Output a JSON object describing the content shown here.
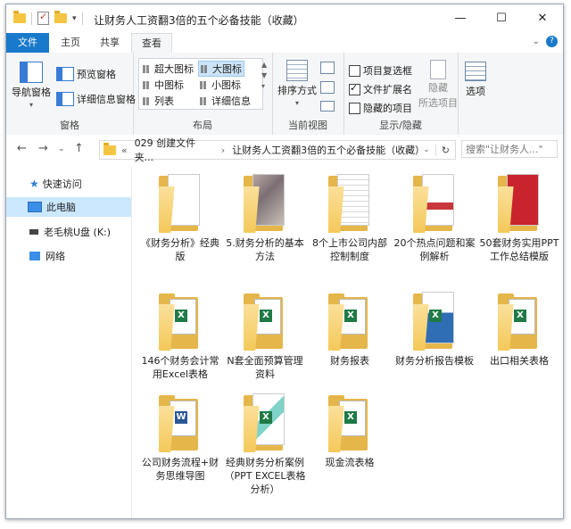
{
  "window": {
    "title": "让财务人工资翻3倍的五个必备技能（收藏）",
    "controls": {
      "minimize": "—",
      "maximize": "☐",
      "close": "✕"
    }
  },
  "ribbon_tabs": [
    {
      "label": "文件"
    },
    {
      "label": "主页"
    },
    {
      "label": "共享"
    },
    {
      "label": "查看"
    }
  ],
  "ribbon": {
    "panes": {
      "label": "窗格",
      "nav_pane": "导航窗格",
      "preview_pane": "预览窗格",
      "details_pane": "详细信息窗格"
    },
    "layout": {
      "label": "布局",
      "xlarge": "超大图标",
      "large": "大图标",
      "medium": "中图标",
      "small": "小图标",
      "list": "列表",
      "details": "详细信息"
    },
    "current_view": {
      "label": "当前视图",
      "sort": "排序方式"
    },
    "show_hide": {
      "label": "显示/隐藏",
      "item_checkboxes": "项目复选框",
      "file_ext": "文件扩展名",
      "hidden_items": "隐藏的项目",
      "hide": "隐藏",
      "selected_items": "所选项目",
      "options": "选项"
    }
  },
  "address": {
    "path_prefix": "«",
    "crumb1": "029 创建文件夹...",
    "crumb2": "让财务人工资翻3倍的五个必备技能（收藏）",
    "search_placeholder": "搜索\"让财务人...\""
  },
  "sidebar": {
    "items": [
      {
        "label": "快速访问"
      },
      {
        "label": "此电脑"
      },
      {
        "label": "老毛桃U盘 (K:)"
      },
      {
        "label": "网络"
      }
    ]
  },
  "folders": [
    {
      "name": "《财务分析》经典版"
    },
    {
      "name": "5.财务分析的基本方法"
    },
    {
      "name": "8个上市公司内部控制制度"
    },
    {
      "name": "20个热点问题和案例解析"
    },
    {
      "name": "50套财务实用PPT工作总结模版"
    },
    {
      "name": "146个财务会计常用Excel表格"
    },
    {
      "name": "N套全面预算管理资料"
    },
    {
      "name": "财务报表"
    },
    {
      "name": "财务分析报告模板"
    },
    {
      "name": "出口相关表格"
    },
    {
      "name": "公司财务流程+财务思维导图"
    },
    {
      "name": "经典财务分析案例（PPT EXCEL表格分析）"
    },
    {
      "name": "现金流表格"
    }
  ],
  "colors": {
    "accent": "#1979ca",
    "folder": "#f4c95a",
    "selection": "#cce8ff"
  }
}
